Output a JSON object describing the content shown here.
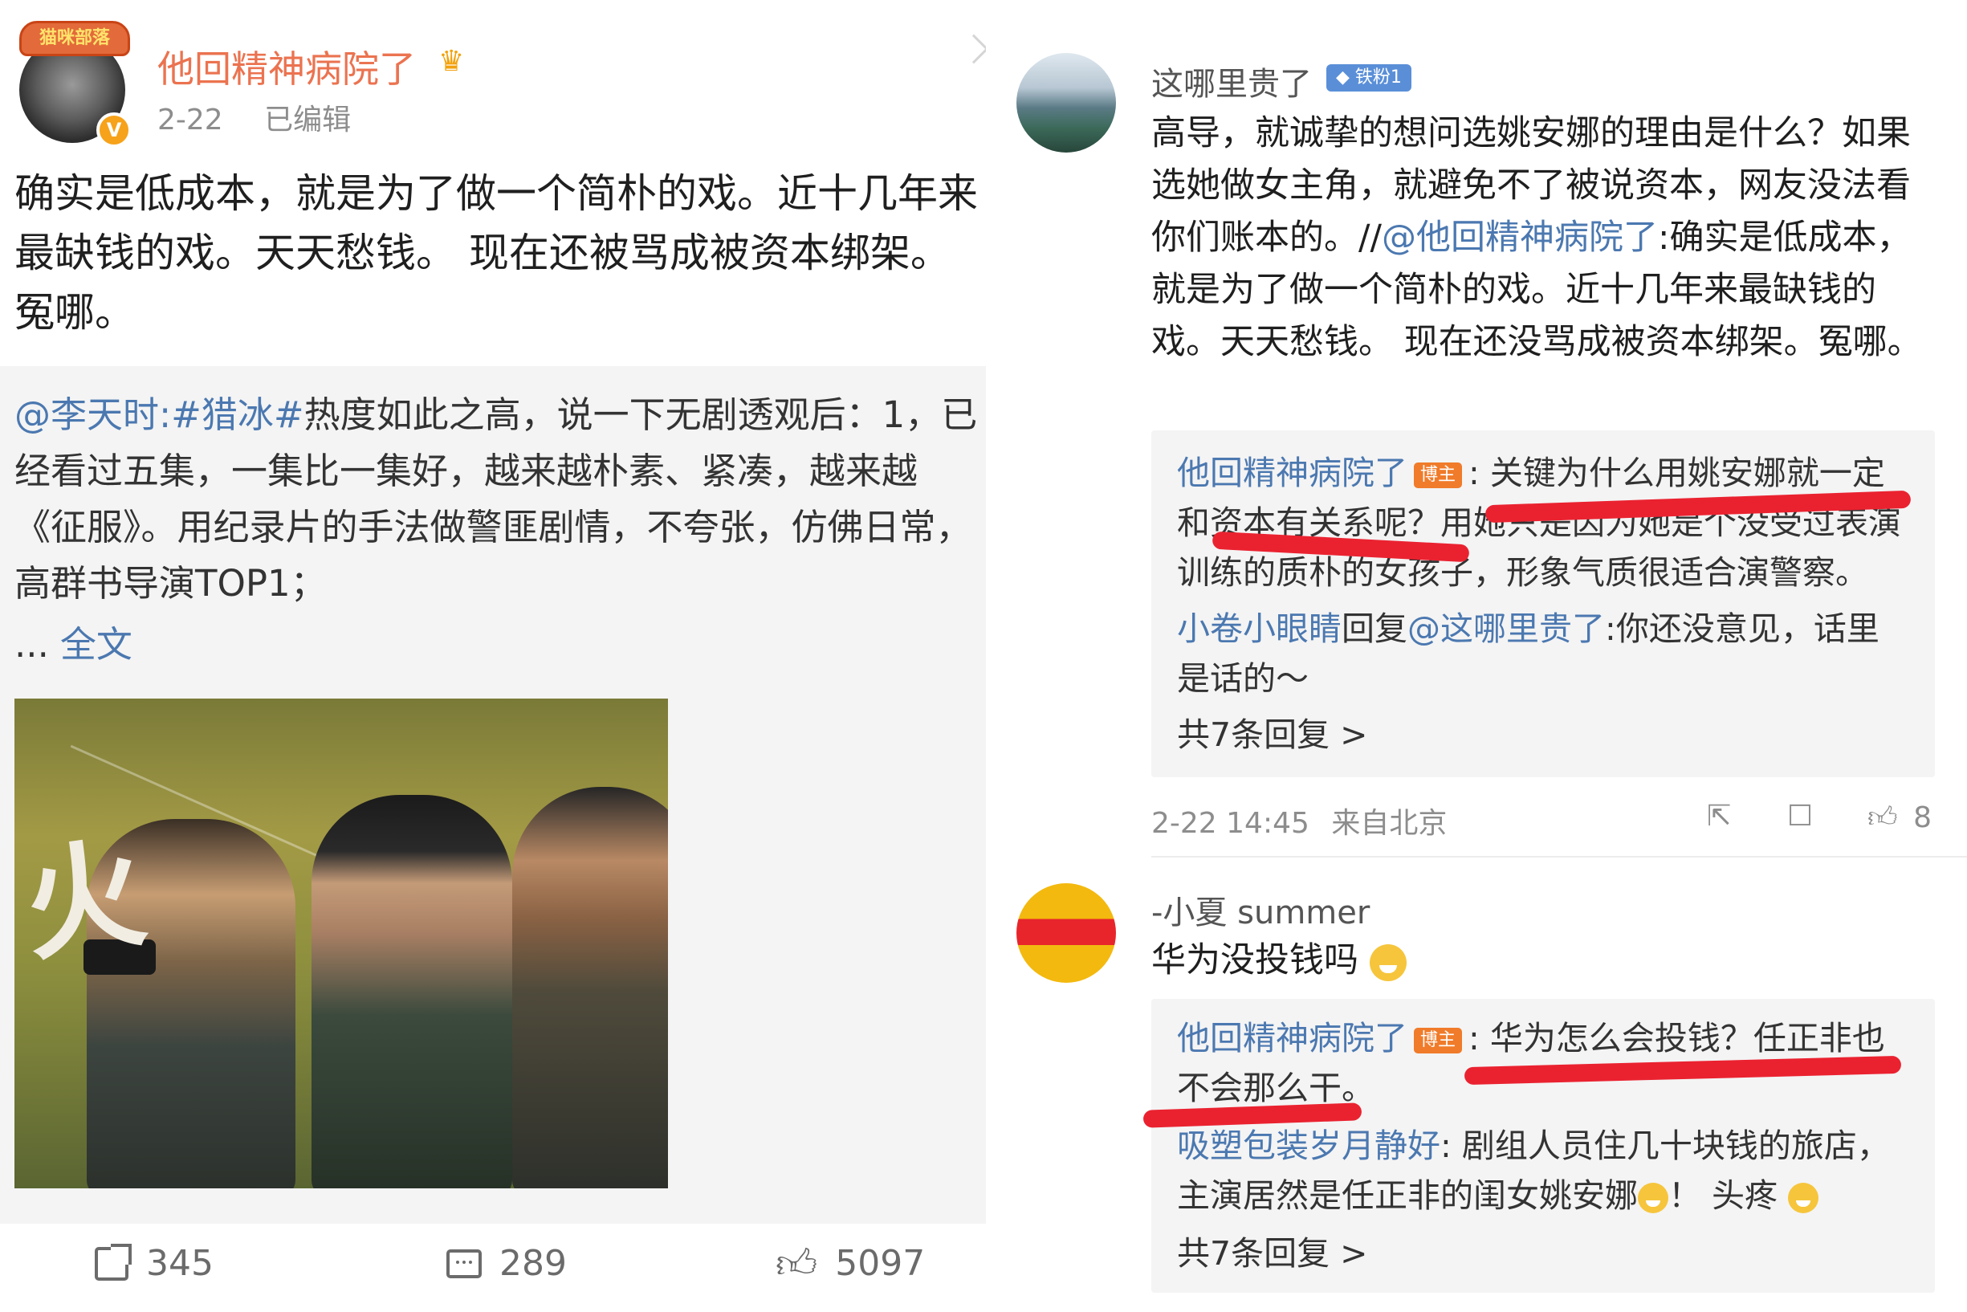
{
  "left_post": {
    "avatar_frame_text": "猫咪部落",
    "username": "他回精神病院了",
    "date": "2-22",
    "edited": "已编辑",
    "text": "确实是低成本，就是为了做一个简朴的戏。近十几年来最缺钱的戏。天天愁钱。 现在还被骂成被资本绑架。冤哪。",
    "repost": {
      "author": "@李天时",
      "topic": ":#猎冰#",
      "text": "热度如此之高，说一下无剧透观后：1，已经看过五集，一集比一集好，越来越朴素、紧凑，越来越《征服》。用纪录片的手法做警匪剧情，不夸张，仿佛日常，高群书导演TOP1；",
      "ellipsis": "...",
      "full_text_link": "全文",
      "image_alt": "猎冰 poster"
    },
    "actions": {
      "share": "345",
      "comment": "289",
      "like": "5097"
    }
  },
  "right_comments": [
    {
      "username": "这哪里贵了",
      "badge": "铁粉1",
      "text_plain": "高导，就诚挚的想问选姚安娜的理由是什么？如果选她做女主角，就避免不了被说资本，网友没法看你们账本的。//",
      "quote_user": "@他回精神病院了",
      "text_rest": ":确实是低成本，就是为了做一个简朴的戏。近十几年来最缺钱的戏。天天愁钱。 现在还没骂成被资本绑架。冤哪。",
      "replies": [
        {
          "user": "他回精神病院了",
          "tag": "博主",
          "text": ": 关键为什么用姚安娜就一定和资本有关系呢？用她只是因为她是个没受过表演训练的质朴的女孩子，形象气质很适合演警察。"
        },
        {
          "user": "小卷小眼睛",
          "mid": "回复",
          "to": "@这哪里贵了",
          "text": ":你还没意见，话里是话的～"
        }
      ],
      "more_replies": "共7条回复 >",
      "time": "2-22 14:45",
      "location": "来自北京",
      "likes": "8"
    },
    {
      "username": "-小夏 summer",
      "text": "华为没投钱吗",
      "replies": [
        {
          "user": "他回精神病院了",
          "tag": "博主",
          "text": ": 华为怎么会投钱？任正非也不会那么干。"
        },
        {
          "user": "吸塑包装岁月静好",
          "text": ": 剧组人员住几十块钱的旅店，主演居然是任正非的闺女姚安娜",
          "tail": "！ 头疼"
        }
      ],
      "more_replies": "共7条回复 >"
    }
  ],
  "colors": {
    "username_orange": "#eb7350",
    "link_blue": "#4b78b0",
    "annotation_red": "#ea2230",
    "bozhu_tag": "#f07b2a"
  }
}
